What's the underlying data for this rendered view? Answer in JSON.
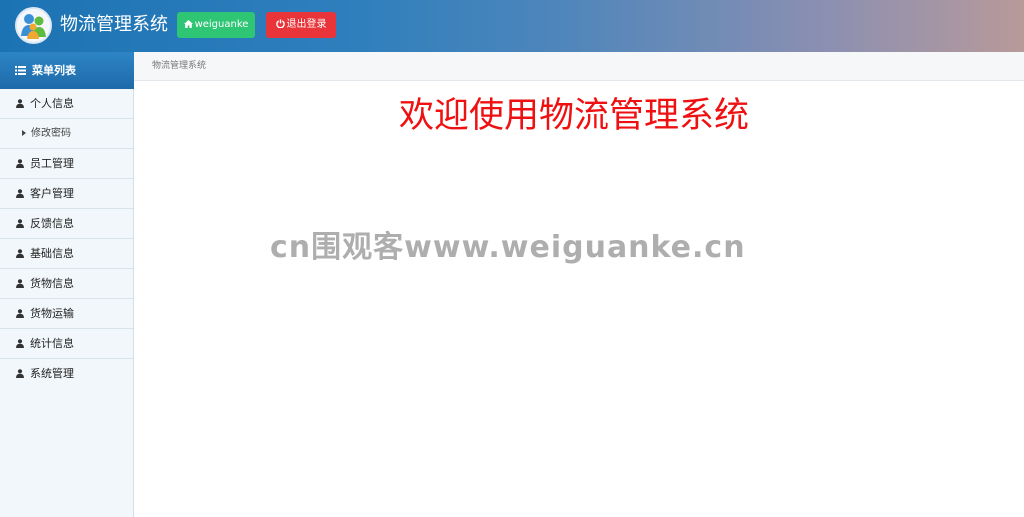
{
  "header": {
    "app_title": "物流管理系统",
    "user_button": "weiguanke",
    "logout_button": "退出登录"
  },
  "sidebar": {
    "menu_title": "菜单列表",
    "items": [
      {
        "label": "个人信息",
        "icon": "user-icon"
      },
      {
        "label": "修改密码",
        "icon": "caret-right-icon"
      },
      {
        "label": "员工管理",
        "icon": "user-icon"
      },
      {
        "label": "客户管理",
        "icon": "user-icon"
      },
      {
        "label": "反馈信息",
        "icon": "user-icon"
      },
      {
        "label": "基础信息",
        "icon": "user-icon"
      },
      {
        "label": "货物信息",
        "icon": "user-icon"
      },
      {
        "label": "货物运输",
        "icon": "user-icon"
      },
      {
        "label": "统计信息",
        "icon": "user-icon"
      },
      {
        "label": "系统管理",
        "icon": "user-icon"
      }
    ]
  },
  "main": {
    "breadcrumb": "物流管理系统",
    "welcome": "欢迎使用物流管理系统",
    "watermark": "cn围观客www.weiguanke.cn"
  },
  "colors": {
    "accent_blue": "#1e6aa9",
    "success_green": "#2ec574",
    "danger_red": "#e9353a",
    "welcome_red": "#ef1111"
  }
}
